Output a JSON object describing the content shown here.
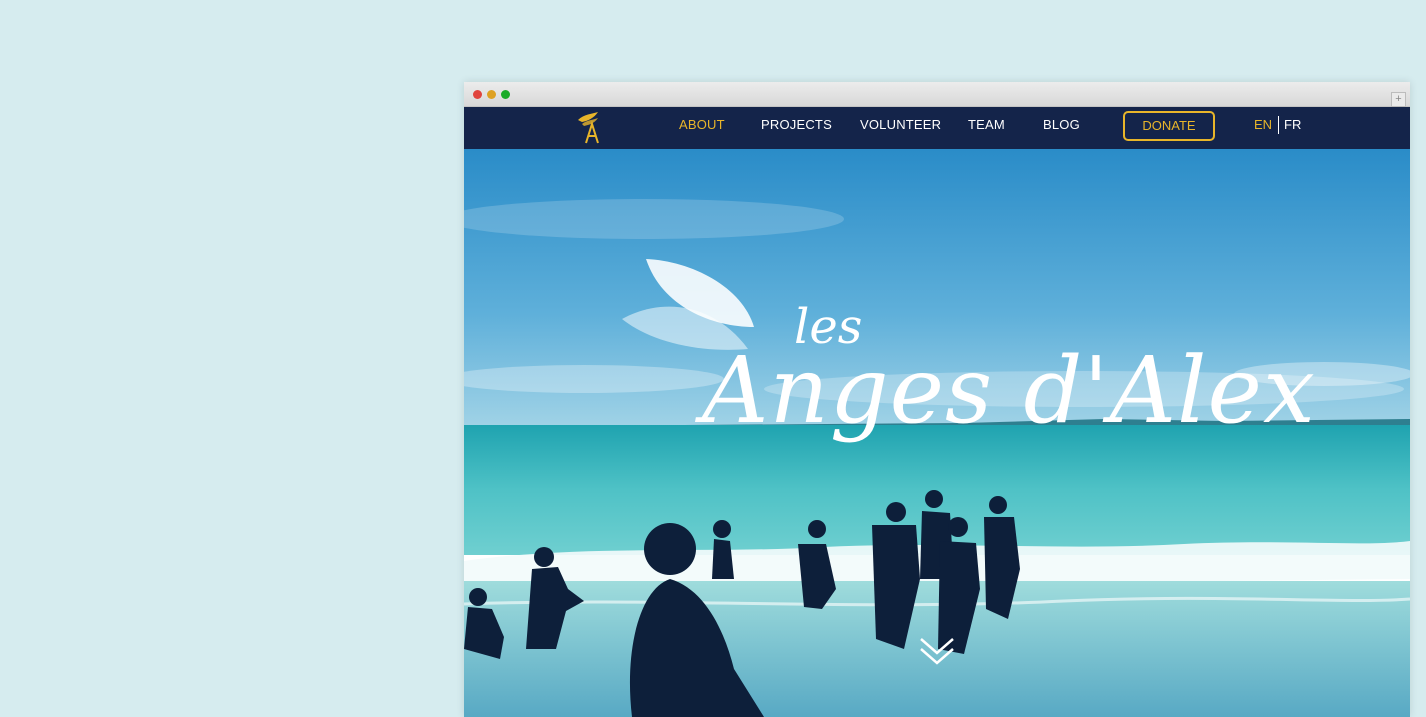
{
  "nav": {
    "items": [
      {
        "label": "ABOUT",
        "active": true
      },
      {
        "label": "PROJECTS",
        "active": false
      },
      {
        "label": "VOLUNTEER",
        "active": false
      },
      {
        "label": "TEAM",
        "active": false
      },
      {
        "label": "BLOG",
        "active": false
      }
    ],
    "donate_label": "DONATE",
    "languages": [
      "EN",
      "FR"
    ],
    "active_language": "EN"
  },
  "hero": {
    "brand_prefix": "les",
    "brand_name": "Anges d'Alex",
    "scroll_icon": "double-chevron-down-icon"
  },
  "icons": {
    "logo": "angel-wing-logo-icon",
    "new_tab": "plus-icon"
  },
  "colors": {
    "nav_background": "#14244a",
    "accent": "#e8b52a",
    "page_background": "#d6ecef"
  }
}
